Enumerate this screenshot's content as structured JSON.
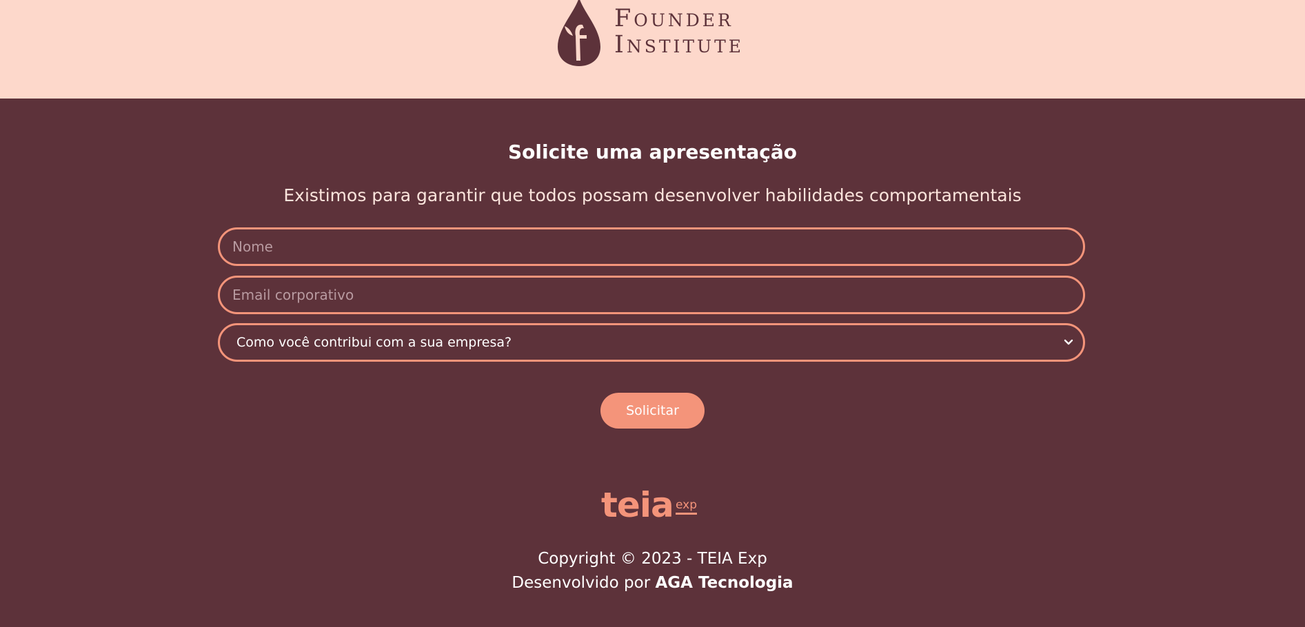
{
  "header": {
    "logo_line1": "Founder",
    "logo_line2": "Institute",
    "logo_icon": "leaf-drop-icon"
  },
  "form": {
    "title": "Solicite uma apresentação",
    "subtitle": "Existimos para garantir que todos possam desenvolver habilidades comportamentais",
    "name_placeholder": "Nome",
    "email_placeholder": "Email corporativo",
    "role_select_value": "Como você contribui com a sua empresa?",
    "submit_label": "Solicitar"
  },
  "footer": {
    "logo_main": "teia",
    "logo_sub": "exp",
    "copyright": "Copyright © 2023 - TEIA Exp",
    "developed_prefix": "Desenvolvido por",
    "developer": "AGA Tecnologia"
  },
  "colors": {
    "header_bg": "#fdd8cb",
    "main_bg": "#5d323a",
    "accent": "#f4947a",
    "text": "#ffffff"
  }
}
